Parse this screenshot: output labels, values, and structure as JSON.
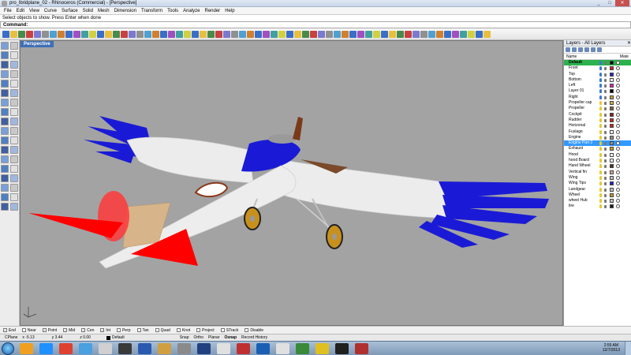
{
  "window": {
    "title": "pro_lbridplane_02 - Rhinoceros (Commercial) - [Perspective]",
    "min": "_",
    "max": "□",
    "close": "✕"
  },
  "menu": [
    "File",
    "Edit",
    "View",
    "Curve",
    "Surface",
    "Solid",
    "Mesh",
    "Dimension",
    "Transform",
    "Tools",
    "Analyze",
    "Render",
    "Help"
  ],
  "prompt": "Select objects to show. Press Enter when done",
  "command_label": "Command:",
  "viewport": {
    "tab": "Perspective"
  },
  "layers": {
    "title": "Layers - All Layers",
    "col_name": "Name",
    "col_mat": "Mate",
    "items": [
      {
        "name": "Default",
        "color": "#000000",
        "row": "default"
      },
      {
        "name": "Front",
        "color": "#d32020"
      },
      {
        "name": "Top",
        "color": "#2020d0"
      },
      {
        "name": "Bottom",
        "color": "#ffffff"
      },
      {
        "name": "Left",
        "color": "#e020c0"
      },
      {
        "name": "Layer 01",
        "color": "#000000"
      },
      {
        "name": "Right",
        "color": "#c8a030"
      },
      {
        "name": "Propeller cap",
        "color": "#d0b040"
      },
      {
        "name": "Propeller",
        "color": "#906030"
      },
      {
        "name": "Cockpit",
        "color": "#8a2020"
      },
      {
        "name": "Rudder",
        "color": "#d32020"
      },
      {
        "name": "Horizonal",
        "color": "#d32020"
      },
      {
        "name": "Fuslage",
        "color": "#ffffff"
      },
      {
        "name": "Engine",
        "color": "#909090"
      },
      {
        "name": "Engine Part 2",
        "color": "#909090",
        "row": "selected"
      },
      {
        "name": "Exhaust",
        "color": "#c0a020"
      },
      {
        "name": "Hood",
        "color": "#ffffff"
      },
      {
        "name": "hood Board",
        "color": "#ffffff"
      },
      {
        "name": "Hand Wheel",
        "color": "#5a3010"
      },
      {
        "name": "Vertical fin",
        "color": "#e0a0a0"
      },
      {
        "name": "Wing",
        "color": "#c0c0c0"
      },
      {
        "name": "Wing Tips",
        "color": "#2020d0"
      },
      {
        "name": "Landgear",
        "color": "#c0c0c0"
      },
      {
        "name": "Wheel",
        "color": "#d09020"
      },
      {
        "name": "wheel Hub",
        "color": "#c0c0c0"
      },
      {
        "name": "tire",
        "color": "#202020"
      }
    ]
  },
  "osnaps": [
    {
      "label": "End",
      "checked": true
    },
    {
      "label": "Near",
      "checked": false
    },
    {
      "label": "Point",
      "checked": true
    },
    {
      "label": "Mid",
      "checked": true
    },
    {
      "label": "Cen",
      "checked": true
    },
    {
      "label": "Int",
      "checked": true
    },
    {
      "label": "Perp",
      "checked": false
    },
    {
      "label": "Tan",
      "checked": false
    },
    {
      "label": "Quad",
      "checked": false
    },
    {
      "label": "Knot",
      "checked": false
    },
    {
      "label": "Project",
      "checked": false
    },
    {
      "label": "STrack",
      "checked": false
    },
    {
      "label": "Disable",
      "checked": false
    }
  ],
  "status": {
    "cplane": "CPlane",
    "x": "x -5.13",
    "y": "y 3.44",
    "z": "z 0.00",
    "layer": "Default",
    "snap": "Snap",
    "ortho": "Ortho",
    "planar": "Planar",
    "osnap": "Osnap",
    "history": "Record History"
  },
  "clock": {
    "time": "2:55 AM",
    "date": "12/7/2013"
  },
  "colors": {
    "fuselage": "#ececec",
    "blue": "#1a1ad6",
    "red": "#ff0000",
    "tan": "#d8b48a",
    "wheel": "#c8901c"
  }
}
